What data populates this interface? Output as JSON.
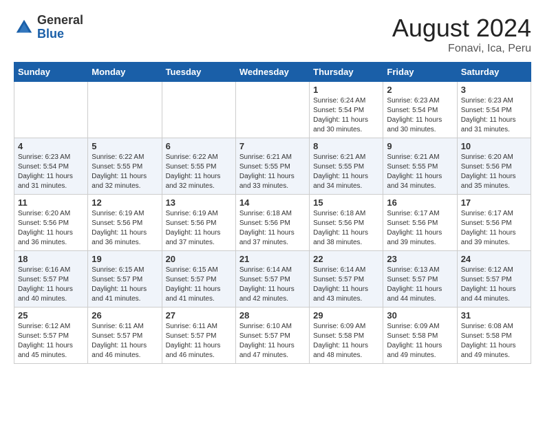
{
  "logo": {
    "general": "General",
    "blue": "Blue"
  },
  "title": {
    "month_year": "August 2024",
    "location": "Fonavi, Ica, Peru"
  },
  "days_of_week": [
    "Sunday",
    "Monday",
    "Tuesday",
    "Wednesday",
    "Thursday",
    "Friday",
    "Saturday"
  ],
  "weeks": [
    [
      {
        "day": "",
        "info": ""
      },
      {
        "day": "",
        "info": ""
      },
      {
        "day": "",
        "info": ""
      },
      {
        "day": "",
        "info": ""
      },
      {
        "day": "1",
        "info": "Sunrise: 6:24 AM\nSunset: 5:54 PM\nDaylight: 11 hours\nand 30 minutes."
      },
      {
        "day": "2",
        "info": "Sunrise: 6:23 AM\nSunset: 5:54 PM\nDaylight: 11 hours\nand 30 minutes."
      },
      {
        "day": "3",
        "info": "Sunrise: 6:23 AM\nSunset: 5:54 PM\nDaylight: 11 hours\nand 31 minutes."
      }
    ],
    [
      {
        "day": "4",
        "info": "Sunrise: 6:23 AM\nSunset: 5:54 PM\nDaylight: 11 hours\nand 31 minutes."
      },
      {
        "day": "5",
        "info": "Sunrise: 6:22 AM\nSunset: 5:55 PM\nDaylight: 11 hours\nand 32 minutes."
      },
      {
        "day": "6",
        "info": "Sunrise: 6:22 AM\nSunset: 5:55 PM\nDaylight: 11 hours\nand 32 minutes."
      },
      {
        "day": "7",
        "info": "Sunrise: 6:21 AM\nSunset: 5:55 PM\nDaylight: 11 hours\nand 33 minutes."
      },
      {
        "day": "8",
        "info": "Sunrise: 6:21 AM\nSunset: 5:55 PM\nDaylight: 11 hours\nand 34 minutes."
      },
      {
        "day": "9",
        "info": "Sunrise: 6:21 AM\nSunset: 5:55 PM\nDaylight: 11 hours\nand 34 minutes."
      },
      {
        "day": "10",
        "info": "Sunrise: 6:20 AM\nSunset: 5:56 PM\nDaylight: 11 hours\nand 35 minutes."
      }
    ],
    [
      {
        "day": "11",
        "info": "Sunrise: 6:20 AM\nSunset: 5:56 PM\nDaylight: 11 hours\nand 36 minutes."
      },
      {
        "day": "12",
        "info": "Sunrise: 6:19 AM\nSunset: 5:56 PM\nDaylight: 11 hours\nand 36 minutes."
      },
      {
        "day": "13",
        "info": "Sunrise: 6:19 AM\nSunset: 5:56 PM\nDaylight: 11 hours\nand 37 minutes."
      },
      {
        "day": "14",
        "info": "Sunrise: 6:18 AM\nSunset: 5:56 PM\nDaylight: 11 hours\nand 37 minutes."
      },
      {
        "day": "15",
        "info": "Sunrise: 6:18 AM\nSunset: 5:56 PM\nDaylight: 11 hours\nand 38 minutes."
      },
      {
        "day": "16",
        "info": "Sunrise: 6:17 AM\nSunset: 5:56 PM\nDaylight: 11 hours\nand 39 minutes."
      },
      {
        "day": "17",
        "info": "Sunrise: 6:17 AM\nSunset: 5:56 PM\nDaylight: 11 hours\nand 39 minutes."
      }
    ],
    [
      {
        "day": "18",
        "info": "Sunrise: 6:16 AM\nSunset: 5:57 PM\nDaylight: 11 hours\nand 40 minutes."
      },
      {
        "day": "19",
        "info": "Sunrise: 6:15 AM\nSunset: 5:57 PM\nDaylight: 11 hours\nand 41 minutes."
      },
      {
        "day": "20",
        "info": "Sunrise: 6:15 AM\nSunset: 5:57 PM\nDaylight: 11 hours\nand 41 minutes."
      },
      {
        "day": "21",
        "info": "Sunrise: 6:14 AM\nSunset: 5:57 PM\nDaylight: 11 hours\nand 42 minutes."
      },
      {
        "day": "22",
        "info": "Sunrise: 6:14 AM\nSunset: 5:57 PM\nDaylight: 11 hours\nand 43 minutes."
      },
      {
        "day": "23",
        "info": "Sunrise: 6:13 AM\nSunset: 5:57 PM\nDaylight: 11 hours\nand 44 minutes."
      },
      {
        "day": "24",
        "info": "Sunrise: 6:12 AM\nSunset: 5:57 PM\nDaylight: 11 hours\nand 44 minutes."
      }
    ],
    [
      {
        "day": "25",
        "info": "Sunrise: 6:12 AM\nSunset: 5:57 PM\nDaylight: 11 hours\nand 45 minutes."
      },
      {
        "day": "26",
        "info": "Sunrise: 6:11 AM\nSunset: 5:57 PM\nDaylight: 11 hours\nand 46 minutes."
      },
      {
        "day": "27",
        "info": "Sunrise: 6:11 AM\nSunset: 5:57 PM\nDaylight: 11 hours\nand 46 minutes."
      },
      {
        "day": "28",
        "info": "Sunrise: 6:10 AM\nSunset: 5:57 PM\nDaylight: 11 hours\nand 47 minutes."
      },
      {
        "day": "29",
        "info": "Sunrise: 6:09 AM\nSunset: 5:58 PM\nDaylight: 11 hours\nand 48 minutes."
      },
      {
        "day": "30",
        "info": "Sunrise: 6:09 AM\nSunset: 5:58 PM\nDaylight: 11 hours\nand 49 minutes."
      },
      {
        "day": "31",
        "info": "Sunrise: 6:08 AM\nSunset: 5:58 PM\nDaylight: 11 hours\nand 49 minutes."
      }
    ]
  ]
}
